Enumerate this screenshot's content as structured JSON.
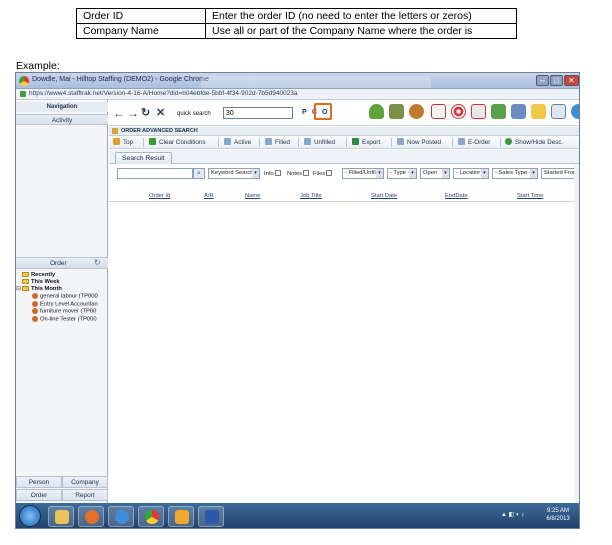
{
  "ref_table": {
    "rows": [
      {
        "field": "Order ID",
        "desc": "Enter the order ID (no need to enter the letters or zeros)"
      },
      {
        "field": "Company Name",
        "desc": "Use all or part of the Company Name where the order is"
      }
    ]
  },
  "example_label": "Example:",
  "window": {
    "title": "Dowdle, Mai - Hilltop Staffing (DEMO2) - Google Chrome",
    "url": "https://www4.stafftrak.net/Version-4-16-A/Home?did=b04ebfde-5bbf-4f34-902d-7b5d940023a"
  },
  "left_panel": {
    "navigation_label": "Navigation",
    "activity_label": "Activity",
    "order_label": "Order",
    "tree": {
      "recently": "Recently",
      "this_week": "This Week",
      "this_month": "This Month",
      "items": [
        "general labour (TP000",
        "Entry Level Accountan",
        "furniture mover (TP00",
        "On-line Tester (TP000"
      ]
    },
    "bottom_buttons": {
      "person": "Person",
      "company": "Company",
      "order": "Order",
      "report": "Report"
    }
  },
  "toolbar": {
    "quick_search_label": "quick search",
    "quick_search_value": "30",
    "opt_p": "P",
    "opt_c": "C",
    "opt_o": "O"
  },
  "section_title": "ORDER ADVANCED SEARCH",
  "buttons": {
    "top": "Top",
    "clear": "Clear Conditions",
    "active": "Active",
    "filled": "Filled",
    "unfilled": "Unfilled",
    "export": "Export",
    "now_posted": "Now Posted",
    "e_order": "E-Order",
    "show_hide": "Show/Hide Desc."
  },
  "search_tab": "Search Result",
  "filters": {
    "keyword_search": "Keyword Search",
    "info": "Info",
    "notes": "Notes",
    "files": "Files",
    "filled_unfilled": "- Filled/Unfille",
    "type": "- Type -",
    "open": "Open",
    "location": "- Locatior",
    "sales_type": "- Sales Type -",
    "started_from": "Started Fron"
  },
  "columns": [
    "Order Id",
    "A/R",
    "Name",
    "Job Title",
    "Start Date",
    "EndDate",
    "Start Time"
  ],
  "taskbar": {
    "time": "9:25 AM",
    "date": "6/8/2013"
  },
  "colors": {
    "highlight": "#e06b1e",
    "taskbar": "#1e3f68"
  }
}
